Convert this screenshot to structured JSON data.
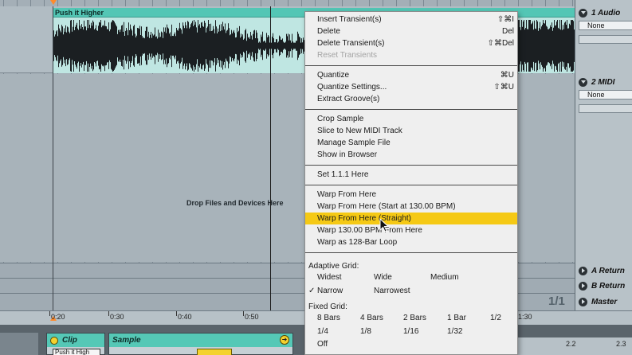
{
  "arrangement": {
    "clip_name": "Push it Higher",
    "drop_hint": "Drop Files and Devices Here",
    "page_counter": "1/1"
  },
  "ruler": {
    "labels": [
      "0:20",
      "0:30",
      "0:40",
      "0:50",
      "1:30"
    ]
  },
  "tracks": {
    "audio": {
      "name": "1 Audio",
      "chooser_value": "None"
    },
    "midi": {
      "name": "2 MIDI",
      "chooser_value": "None"
    },
    "return_a": {
      "name": "A Return"
    },
    "return_b": {
      "name": "B Return"
    },
    "master": {
      "name": "Master"
    }
  },
  "detail": {
    "clip_title": "Clip",
    "clip_name_field": "Push it High",
    "sample_title": "Sample",
    "right_ruler": [
      "2.2",
      "2.3"
    ]
  },
  "context_menu": {
    "items": [
      {
        "label": "Insert Transient(s)",
        "shortcut": "⇧⌘I",
        "disabled": false
      },
      {
        "label": "Delete",
        "shortcut": "Del",
        "disabled": false
      },
      {
        "label": "Delete Transient(s)",
        "shortcut": "⇧⌘Del",
        "disabled": false
      },
      {
        "label": "Reset Transients",
        "shortcut": "",
        "disabled": true
      },
      {
        "label": "Quantize",
        "shortcut": "⌘U",
        "disabled": false
      },
      {
        "label": "Quantize Settings...",
        "shortcut": "⇧⌘U",
        "disabled": false
      },
      {
        "label": "Extract Groove(s)",
        "shortcut": "",
        "disabled": false
      },
      {
        "label": "Crop Sample",
        "shortcut": "",
        "disabled": false
      },
      {
        "label": "Slice to New MIDI Track",
        "shortcut": "",
        "disabled": false
      },
      {
        "label": "Manage Sample File",
        "shortcut": "",
        "disabled": false
      },
      {
        "label": "Show in Browser",
        "shortcut": "",
        "disabled": false
      },
      {
        "label": "Set 1.1.1 Here",
        "shortcut": "",
        "disabled": false
      },
      {
        "label": "Warp From Here",
        "shortcut": "",
        "disabled": false
      },
      {
        "label": "Warp From Here (Start at 130.00 BPM)",
        "shortcut": "",
        "disabled": false
      },
      {
        "label": "Warp From Here (Straight)",
        "shortcut": "",
        "disabled": false,
        "highlighted": true
      },
      {
        "label": "Warp 130.00 BPM From Here",
        "shortcut": "",
        "disabled": false
      },
      {
        "label": "Warp as 128-Bar Loop",
        "shortcut": "",
        "disabled": false
      }
    ],
    "adaptive_grid": {
      "label": "Adaptive Grid:",
      "options": [
        "Widest",
        "Wide",
        "Medium",
        "Narrow",
        "Narrowest"
      ],
      "selected": "Narrow",
      "checkmark": "✓"
    },
    "fixed_grid": {
      "label": "Fixed Grid:",
      "options": [
        "8 Bars",
        "4 Bars",
        "2 Bars",
        "1 Bar",
        "1/2",
        "1/4",
        "1/8",
        "1/16",
        "1/32",
        "Off"
      ]
    }
  },
  "colors": {
    "clip_header": "#53c6b5",
    "highlight": "#f5c915",
    "waveform": "#1b1f22"
  },
  "icons": {
    "track_collapse": "triangle-down-icon",
    "return_expand": "triangle-right-icon",
    "clip_activator": "yellow-dot-icon",
    "sample_nav": "arrow-right-icon"
  }
}
